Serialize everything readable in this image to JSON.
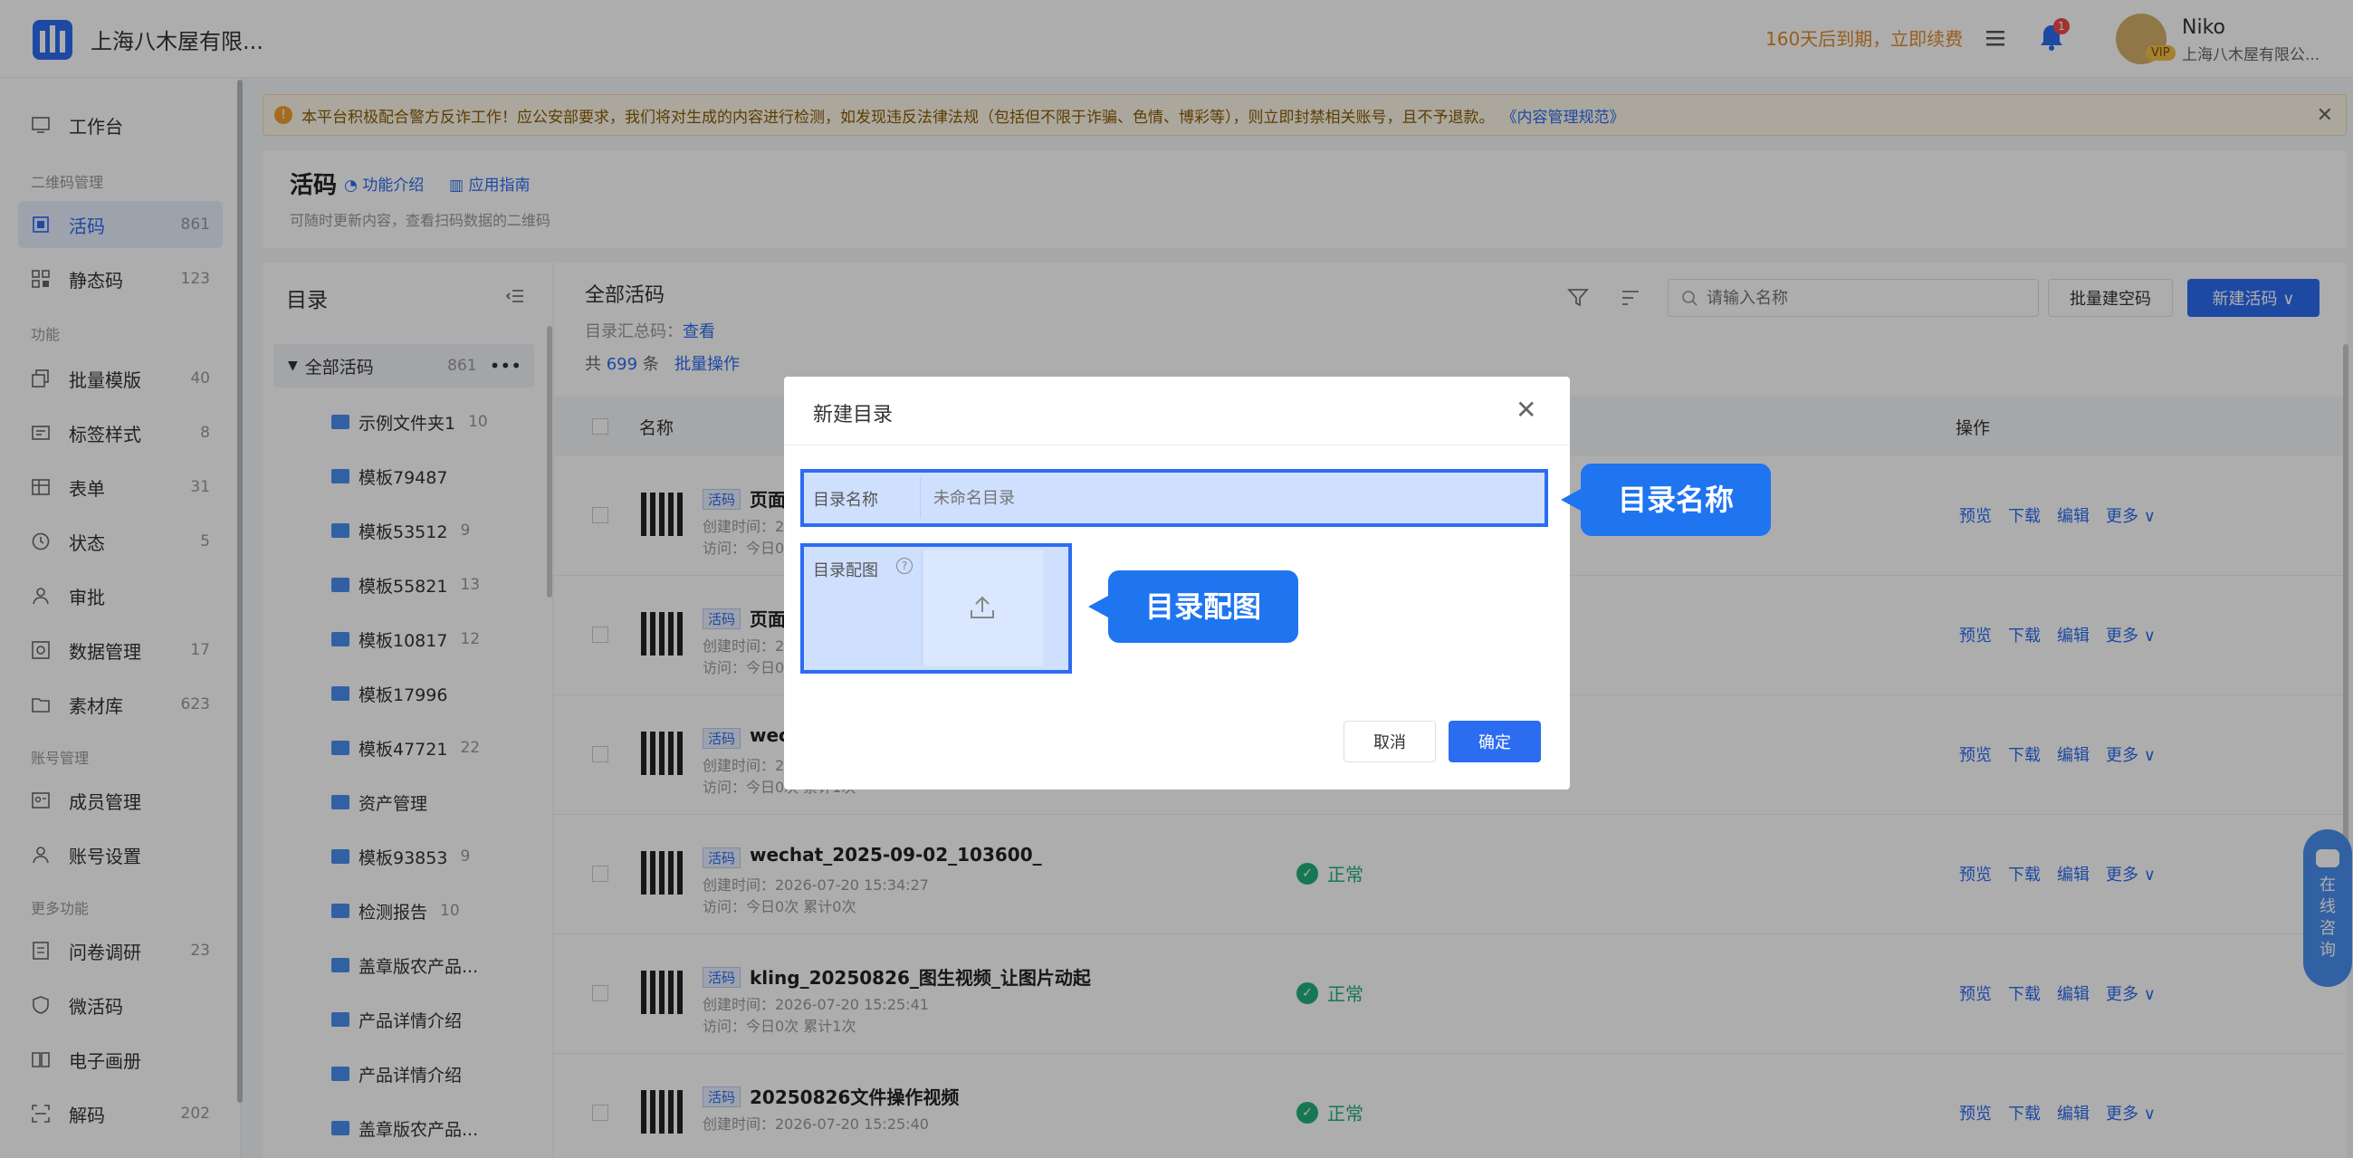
{
  "topbar": {
    "brand": "上海八木屋有限...",
    "expire_text": "160天后到期，立即续费",
    "notification_count": "1",
    "vip": "VIP",
    "user_name": "Niko",
    "user_company": "上海八木屋有限公..."
  },
  "sidebar": {
    "items": [
      {
        "label": "工作台",
        "count": ""
      },
      {
        "section": "二维码管理"
      },
      {
        "label": "活码",
        "count": "861"
      },
      {
        "label": "静态码",
        "count": "123"
      },
      {
        "section": "功能"
      },
      {
        "label": "批量模版",
        "count": "40"
      },
      {
        "label": "标签样式",
        "count": "8"
      },
      {
        "label": "表单",
        "count": "31"
      },
      {
        "label": "状态",
        "count": "5"
      },
      {
        "label": "审批",
        "count": ""
      },
      {
        "label": "数据管理",
        "count": "17"
      },
      {
        "label": "素材库",
        "count": "623"
      },
      {
        "section": "账号管理"
      },
      {
        "label": "成员管理",
        "count": ""
      },
      {
        "label": "账号设置",
        "count": ""
      },
      {
        "section": "更多功能"
      },
      {
        "label": "问卷调研",
        "count": "23"
      },
      {
        "label": "微活码",
        "count": ""
      },
      {
        "label": "电子画册",
        "count": ""
      },
      {
        "label": "解码",
        "count": "202"
      }
    ]
  },
  "notice": {
    "text": "本平台积极配合警方反诈工作！应公安部要求，我们将对生成的内容进行检测，如发现违反法律法规（包括但不限于诈骗、色情、博彩等），则立即封禁相关账号，且不予退款。",
    "link": "《内容管理规范》"
  },
  "page_header": {
    "title": "活码",
    "link_intro": "功能介绍",
    "link_guide": "应用指南",
    "subtitle": "可随时更新内容，查看扫码数据的二维码"
  },
  "directory": {
    "title": "目录",
    "all_label": "全部活码",
    "all_count": "861",
    "folders": [
      {
        "name": "示例文件夹1",
        "count": "10"
      },
      {
        "name": "模板79487",
        "count": ""
      },
      {
        "name": "模板53512",
        "count": "9"
      },
      {
        "name": "模板55821",
        "count": "13"
      },
      {
        "name": "模板10817",
        "count": "12"
      },
      {
        "name": "模板17996",
        "count": ""
      },
      {
        "name": "模板47721",
        "count": "22"
      },
      {
        "name": "资产管理",
        "count": ""
      },
      {
        "name": "模板93853",
        "count": "9"
      },
      {
        "name": "检测报告",
        "count": "10"
      },
      {
        "name": "盖章版农产品...",
        "count": ""
      },
      {
        "name": "产品详情介绍",
        "count": ""
      },
      {
        "name": "产品详情介绍",
        "count": ""
      },
      {
        "name": "盖章版农产品...",
        "count": ""
      }
    ]
  },
  "main": {
    "title": "全部活码",
    "summary_label": "目录汇总码：",
    "summary_link": "查看",
    "count_prefix": "共",
    "count_value": "699",
    "count_suffix": "条",
    "batch_op": "批量操作",
    "search_placeholder": "请输入名称",
    "bulk_button": "批量建空码",
    "new_button": "新建活码 ∨",
    "col_name": "名称",
    "col_ops": "操作",
    "rows": [
      {
        "tag": "活码",
        "name": "页面",
        "created": "创建时间：2",
        "visits": "访问：今日0",
        "status": ""
      },
      {
        "tag": "活码",
        "name": "页面",
        "created": "创建时间：2",
        "visits": "访问：今日0",
        "status": ""
      },
      {
        "tag": "活码",
        "name": "wec",
        "created": "创建时间：2",
        "visits": "访问：今日0次 累计1次",
        "status": ""
      },
      {
        "tag": "活码",
        "name": "wechat_2025-09-02_103600_",
        "created": "创建时间：2026-07-20 15:34:27",
        "visits": "访问：今日0次 累计0次",
        "status": "正常"
      },
      {
        "tag": "活码",
        "name": "kling_20250826_图生视频_让图片动起",
        "created": "创建时间：2026-07-20 15:25:41",
        "visits": "访问：今日0次 累计1次",
        "status": "正常"
      },
      {
        "tag": "活码",
        "name": "20250826文件操作视频",
        "created": "创建时间：2026-07-20 15:25:40",
        "visits": "",
        "status": "正常"
      }
    ],
    "ops": {
      "preview": "预览",
      "download": "下载",
      "edit": "编辑",
      "more": "更多 ∨"
    }
  },
  "modal": {
    "title": "新建目录",
    "name_label": "目录名称",
    "name_placeholder": "未命名目录",
    "image_label": "目录配图",
    "cancel": "取消",
    "confirm": "确定"
  },
  "callouts": {
    "name": "目录名称",
    "image": "目录配图"
  },
  "chat": {
    "label": "在线咨询"
  },
  "colors": {
    "accent": "#2c6cf1",
    "success": "#22b07d",
    "warning": "#f0a030",
    "callout": "#1f74f0"
  }
}
